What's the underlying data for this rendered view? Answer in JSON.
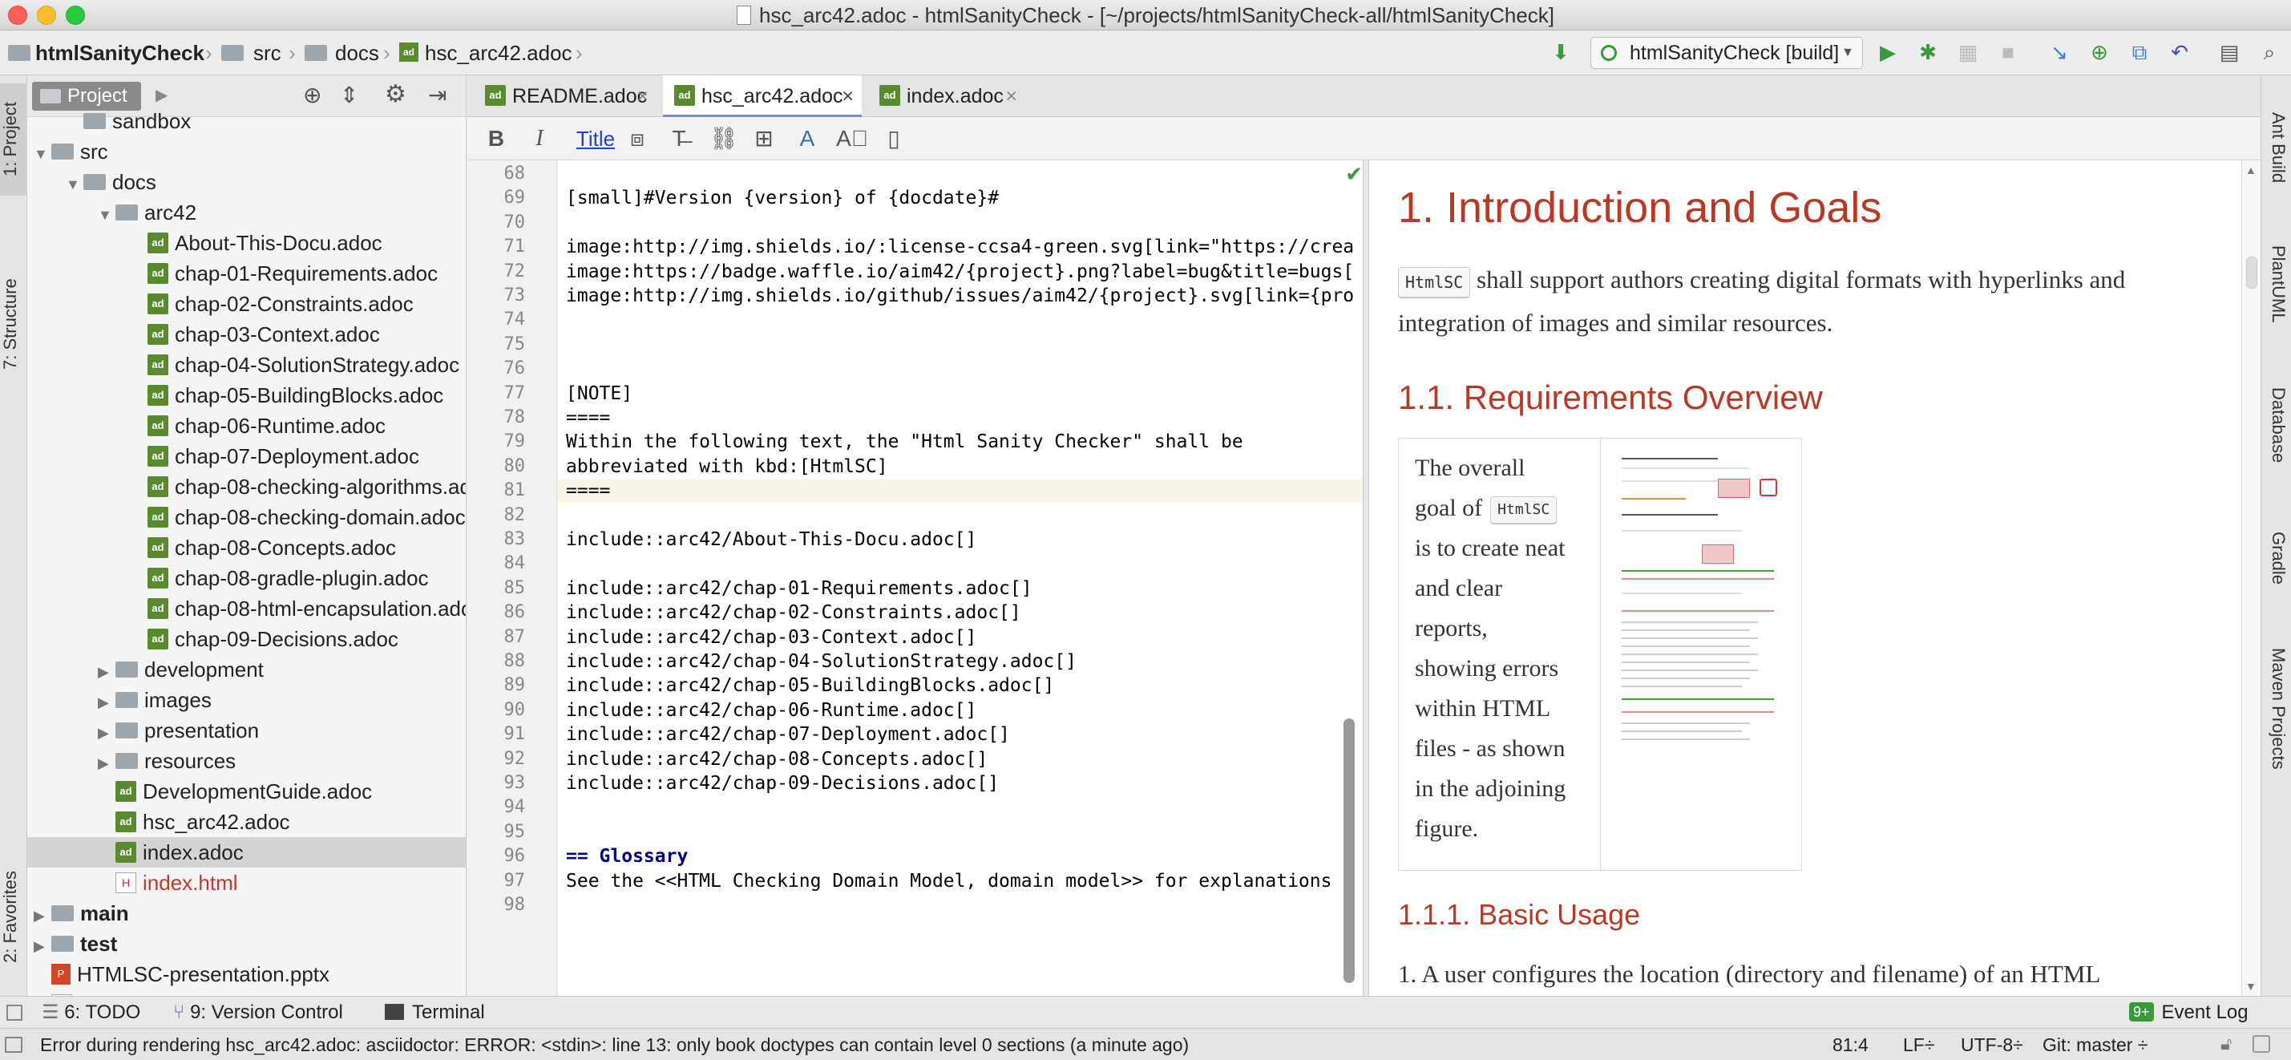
{
  "window": {
    "title": "hsc_arc42.adoc - htmlSanityCheck - [~/projects/htmlSanityCheck-all/htmlSanityCheck]"
  },
  "breadcrumb": {
    "root": "htmlSanityCheck",
    "items": [
      "src",
      "docs",
      "hsc_arc42.adoc"
    ]
  },
  "toolbar": {
    "run_config": "htmlSanityCheck [build]"
  },
  "left_strip": {
    "project": "1: Project",
    "structure": "7: Structure",
    "favorites": "2: Favorites"
  },
  "right_strip": {
    "ant": "Ant Build",
    "plantuml": "PlantUML",
    "database": "Database",
    "gradle": "Gradle",
    "maven": "Maven Projects"
  },
  "project_panel": {
    "title": "Project",
    "tree": [
      {
        "label": "sandbox",
        "kind": "folder",
        "level": 1,
        "arrow": ""
      },
      {
        "label": "src",
        "kind": "folder",
        "level": 0,
        "arrow": "▼"
      },
      {
        "label": "docs",
        "kind": "folder",
        "level": 1,
        "arrow": "▼"
      },
      {
        "label": "arc42",
        "kind": "folder",
        "level": 2,
        "arrow": "▼"
      },
      {
        "label": "About-This-Docu.adoc",
        "kind": "adoc",
        "level": 3
      },
      {
        "label": "chap-01-Requirements.adoc",
        "kind": "adoc",
        "level": 3
      },
      {
        "label": "chap-02-Constraints.adoc",
        "kind": "adoc",
        "level": 3
      },
      {
        "label": "chap-03-Context.adoc",
        "kind": "adoc",
        "level": 3
      },
      {
        "label": "chap-04-SolutionStrategy.adoc",
        "kind": "adoc",
        "level": 3
      },
      {
        "label": "chap-05-BuildingBlocks.adoc",
        "kind": "adoc",
        "level": 3
      },
      {
        "label": "chap-06-Runtime.adoc",
        "kind": "adoc",
        "level": 3
      },
      {
        "label": "chap-07-Deployment.adoc",
        "kind": "adoc",
        "level": 3
      },
      {
        "label": "chap-08-checking-algorithms.adoc",
        "kind": "adoc",
        "level": 3
      },
      {
        "label": "chap-08-checking-domain.adoc",
        "kind": "adoc",
        "level": 3
      },
      {
        "label": "chap-08-Concepts.adoc",
        "kind": "adoc",
        "level": 3
      },
      {
        "label": "chap-08-gradle-plugin.adoc",
        "kind": "adoc",
        "level": 3
      },
      {
        "label": "chap-08-html-encapsulation.adoc",
        "kind": "adoc",
        "level": 3
      },
      {
        "label": "chap-09-Decisions.adoc",
        "kind": "adoc",
        "level": 3
      },
      {
        "label": "development",
        "kind": "folder",
        "level": 2,
        "arrow": "▶"
      },
      {
        "label": "images",
        "kind": "folder",
        "level": 2,
        "arrow": "▶"
      },
      {
        "label": "presentation",
        "kind": "folder",
        "level": 2,
        "arrow": "▶"
      },
      {
        "label": "resources",
        "kind": "folder",
        "level": 2,
        "arrow": "▶"
      },
      {
        "label": "DevelopmentGuide.adoc",
        "kind": "adoc",
        "level": 2
      },
      {
        "label": "hsc_arc42.adoc",
        "kind": "adoc",
        "level": 2
      },
      {
        "label": "index.adoc",
        "kind": "adoc",
        "level": 2,
        "selected": true
      },
      {
        "label": "index.html",
        "kind": "html",
        "level": 2
      },
      {
        "label": "main",
        "kind": "folder",
        "level": 0,
        "arrow": "▶",
        "bold": true
      },
      {
        "label": "test",
        "kind": "folder",
        "level": 0,
        "arrow": "▶",
        "bold": true
      },
      {
        "label": "HTMLSC-presentation.pptx",
        "kind": "pptx",
        "level": 0
      },
      {
        "label": ".gitignore",
        "kind": "file",
        "level": 0
      }
    ]
  },
  "tabs": [
    {
      "label": "README.adoc",
      "active": false
    },
    {
      "label": "hsc_arc42.adoc",
      "active": true
    },
    {
      "label": "index.adoc",
      "active": false
    }
  ],
  "format_toolbar": {
    "title_label": "Title"
  },
  "editor": {
    "lines": [
      {
        "n": "68",
        "text": ""
      },
      {
        "n": "69",
        "text": "[small]#Version {version} of {docdate}#"
      },
      {
        "n": "70",
        "text": ""
      },
      {
        "n": "71",
        "text": "image:http://img.shields.io/:license-ccsa4-green.svg[link=\"https://crea"
      },
      {
        "n": "72",
        "text": "image:https://badge.waffle.io/aim42/{project}.png?label=bug&title=bugs["
      },
      {
        "n": "73",
        "text": "image:http://img.shields.io/github/issues/aim42/{project}.svg[link={pro"
      },
      {
        "n": "74",
        "text": ""
      },
      {
        "n": "75",
        "text": ""
      },
      {
        "n": "76",
        "text": ""
      },
      {
        "n": "77",
        "text": "[NOTE]"
      },
      {
        "n": "78",
        "text": "===="
      },
      {
        "n": "79",
        "text": "Within the following text, the \"Html Sanity Checker\" shall be"
      },
      {
        "n": "80",
        "text": "abbreviated with kbd:[HtmlSC]"
      },
      {
        "n": "81",
        "text": "====",
        "highlight": true
      },
      {
        "n": "82",
        "text": ""
      },
      {
        "n": "83",
        "text": "include::arc42/About-This-Docu.adoc[]"
      },
      {
        "n": "84",
        "text": ""
      },
      {
        "n": "85",
        "text": "include::arc42/chap-01-Requirements.adoc[]"
      },
      {
        "n": "86",
        "text": "include::arc42/chap-02-Constraints.adoc[]"
      },
      {
        "n": "87",
        "text": "include::arc42/chap-03-Context.adoc[]"
      },
      {
        "n": "88",
        "text": "include::arc42/chap-04-SolutionStrategy.adoc[]"
      },
      {
        "n": "89",
        "text": "include::arc42/chap-05-BuildingBlocks.adoc[]"
      },
      {
        "n": "90",
        "text": "include::arc42/chap-06-Runtime.adoc[]"
      },
      {
        "n": "91",
        "text": "include::arc42/chap-07-Deployment.adoc[]"
      },
      {
        "n": "92",
        "text": "include::arc42/chap-08-Concepts.adoc[]"
      },
      {
        "n": "93",
        "text": "include::arc42/chap-09-Decisions.adoc[]"
      },
      {
        "n": "94",
        "text": ""
      },
      {
        "n": "95",
        "text": ""
      },
      {
        "n": "96",
        "text": "== Glossary",
        "keyword": true
      },
      {
        "n": "97",
        "text": "See the <<HTML Checking Domain Model, domain model>> for explanations o"
      },
      {
        "n": "98",
        "text": ""
      }
    ]
  },
  "preview": {
    "h1": "1. Introduction and Goals",
    "intro_kbd": "HtmlSC",
    "intro_line1": "shall support authors creating digital formats with hyperlinks and",
    "intro_line2": "integration of images and similar resources.",
    "h2": "1.1. Requirements Overview",
    "cell_lines": [
      "The overall",
      "goal of",
      "is to create neat",
      "and clear",
      "reports,",
      "showing errors",
      "within HTML",
      "files - as shown",
      "in the adjoining",
      "figure."
    ],
    "cell_kbd": "HtmlSC",
    "h3": "1.1.1. Basic Usage",
    "list_item": "1.  A user configures the location (directory and filename) of an HTML"
  },
  "bottom_tools": {
    "todo": "6: TODO",
    "vcs": "9: Version Control",
    "terminal": "Terminal",
    "event_count": "9+",
    "event_log": "Event Log"
  },
  "status": {
    "message": "Error during rendering hsc_arc42.adoc: asciidoctor: ERROR: <stdin>: line 13: only book doctypes can contain level 0 sections (a minute ago)",
    "position": "81:4",
    "line_sep": "LF÷",
    "encoding": "UTF-8÷",
    "git": "Git: master ÷"
  },
  "colors": {
    "accent": "#ba3925",
    "adoc_icon": "#5a8a2f",
    "run": "#3a9a3a"
  }
}
